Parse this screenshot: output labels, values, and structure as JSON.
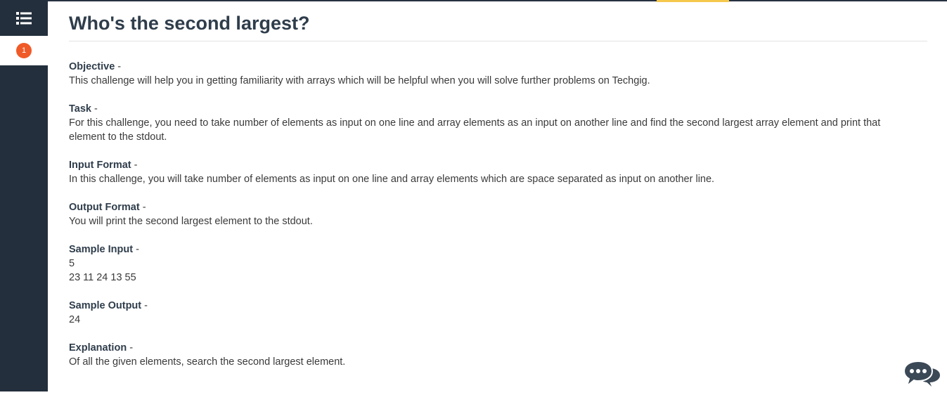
{
  "sidebar": {
    "question_number": "1"
  },
  "title": "Who's the second largest?",
  "sections": {
    "objective": {
      "label": "Objective",
      "dash": " -",
      "text": "This challenge will help you in getting familiarity with arrays which will be helpful when you will solve further problems on Techgig."
    },
    "task": {
      "label": "Task",
      "dash": " -",
      "text": "For this challenge, you need to take number of elements as input on one line and array elements as an input on another line and find the second largest array element and print that element to the stdout."
    },
    "input_format": {
      "label": "Input Format",
      "dash": " -",
      "text": "In this challenge, you will take number of elements as input on one line and array elements which are space separated as input on another line."
    },
    "output_format": {
      "label": "Output Format",
      "dash": " -",
      "text": "You will print the second largest element to the stdout."
    },
    "sample_input": {
      "label": "Sample Input",
      "dash": " -",
      "line1": "5",
      "line2": "23 11 24 13 55"
    },
    "sample_output": {
      "label": "Sample Output",
      "dash": " -",
      "text": "24"
    },
    "explanation": {
      "label": "Explanation",
      "dash": " -",
      "text": "Of all the given elements, search the second largest element."
    }
  },
  "icons": {
    "menu": "list-icon",
    "chat": "chat-bubbles-icon"
  },
  "colors": {
    "sidebar": "#232f3c",
    "badge": "#f05a28",
    "accent": "#f5c84c",
    "title": "#2f3d4b"
  }
}
